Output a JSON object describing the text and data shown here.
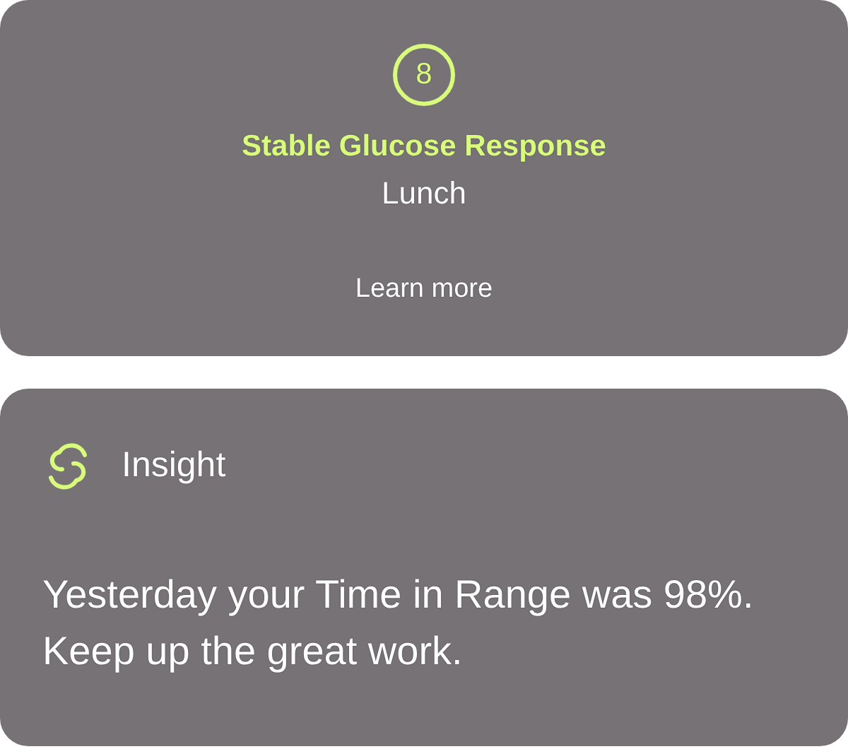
{
  "score_card": {
    "score": "8",
    "title": "Stable Glucose Response",
    "meal": "Lunch",
    "link": "Learn more"
  },
  "insight_card": {
    "label": "Insight",
    "message": "Yesterday your Time in Range was 98%. Keep up the great work."
  }
}
